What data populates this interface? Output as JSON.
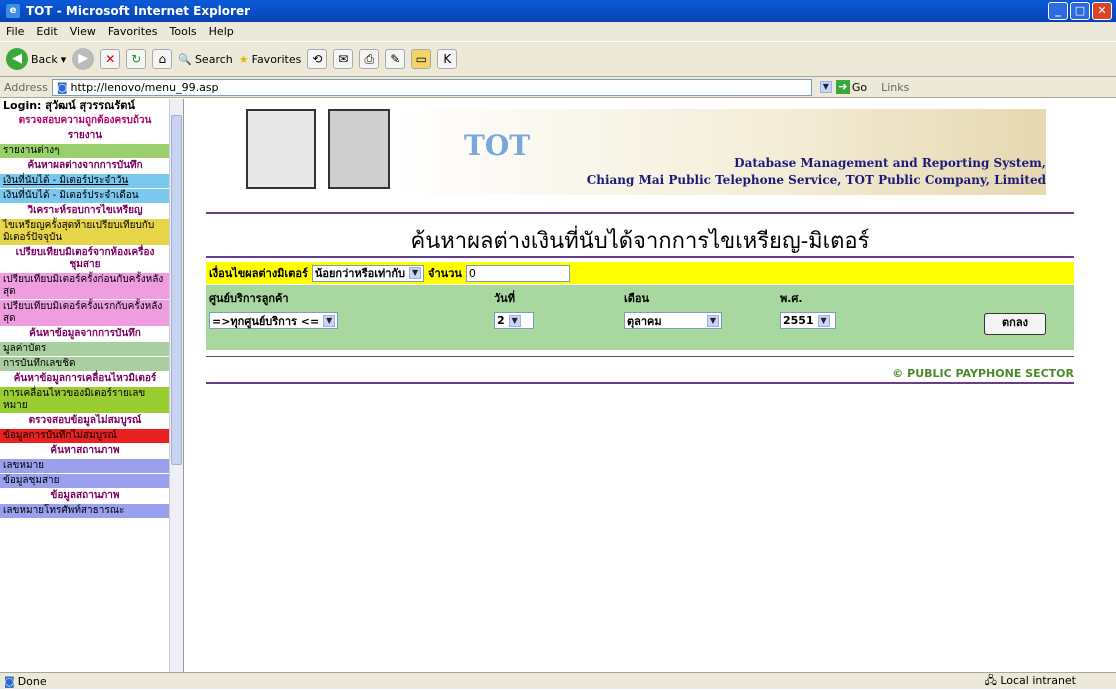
{
  "window": {
    "title": "TOT - Microsoft Internet Explorer"
  },
  "menu": [
    "File",
    "Edit",
    "View",
    "Favorites",
    "Tools",
    "Help"
  ],
  "toolbar": {
    "back": "Back",
    "search": "Search",
    "favorites": "Favorites"
  },
  "address": {
    "label": "Address",
    "url": "http://lenovo/menu_99.asp",
    "go": "Go",
    "links": "Links"
  },
  "sidebar": {
    "login": "Login: สุวัฒน์ สุวรรณรัตน์",
    "items": [
      {
        "text": "ตรวจสอบความถูกต้องครบถ้วน",
        "kind": "head-red"
      },
      {
        "text": "รายงาน",
        "kind": "head"
      },
      {
        "text": "รายงานต่างๆ",
        "kind": "green"
      },
      {
        "text": "ค้นหาผลต่างจากการบันทึก",
        "kind": "head"
      },
      {
        "text": "เงินที่นับได้ - มิเตอร์ประจำวัน",
        "kind": "cyan"
      },
      {
        "text": "เงินที่นับได้ - มิเตอร์ประจำเดือน",
        "kind": "cyan"
      },
      {
        "text": "วิเคราะห์รอบการไขเหรียญ",
        "kind": "head"
      },
      {
        "text": "ไขเหรียญครั้งสุดท้ายเปรียบเทียบกับมิเตอร์ปัจจุบัน",
        "kind": "yellow"
      },
      {
        "text": "เปรียบเทียบมิเตอร์จากห้องเครื่องชุมสาย",
        "kind": "head"
      },
      {
        "text": "เปรียบเทียบมิเตอร์ครั้งก่อนกับครั้งหลังสุด",
        "kind": "pink"
      },
      {
        "text": "เปรียบเทียบมิเตอร์ครั้งแรกกับครั้งหลังสุด",
        "kind": "pink"
      },
      {
        "text": "ค้นหาข้อมูลจากการบันทึก",
        "kind": "head"
      },
      {
        "text": "มูลค่าบัตร",
        "kind": "greygreen"
      },
      {
        "text": "การบันทึกเลขชิด",
        "kind": "greygreen"
      },
      {
        "text": "ค้นหาข้อมูลการเคลื่อนไหวมิเตอร์",
        "kind": "head"
      },
      {
        "text": "การเคลื่อนไหวของมิเตอร์รายเลขหมาย",
        "kind": "lime"
      },
      {
        "text": "ตรวจสอบข้อมูลไม่สมบูรณ์",
        "kind": "head"
      },
      {
        "text": "ข้อมูลการบันทึกไม่สมบูรณ์",
        "kind": "red"
      },
      {
        "text": "ค้นหาสถานภาพ",
        "kind": "head"
      },
      {
        "text": "เลขหมาย",
        "kind": "violet"
      },
      {
        "text": "ข้อมูลชุมสาย",
        "kind": "violet"
      },
      {
        "text": "ข้อมูลสถานภาพ",
        "kind": "head"
      },
      {
        "text": "เลขหมายโทรศัพท์สาธารณะ",
        "kind": "violet"
      }
    ]
  },
  "banner": {
    "logo": "TOT",
    "line1": "Database Management and Reporting System,",
    "line2": "Chiang Mai Public Telephone Service, TOT Public Company, Limited"
  },
  "page": {
    "title": "ค้นหาผลต่างเงินที่นับได้จากการไขเหรียญ-มิเตอร์"
  },
  "filter": {
    "label": "เงื่อนไขผลต่างมิเตอร์",
    "operator": "น้อยกว่าหรือเท่ากับ",
    "amount_label": "จำนวน",
    "amount": "0"
  },
  "form": {
    "center_label": "ศูนย์บริการลูกค้า",
    "center_value": "=>ทุกศูนย์บริการ <=",
    "day_label": "วันที่",
    "day_value": "2",
    "month_label": "เดือน",
    "month_value": "ตุลาคม",
    "year_label": "พ.ศ.",
    "year_value": "2551",
    "submit": "ตกลง"
  },
  "footer": {
    "copyright": "© PUBLIC PAYPHONE SECTOR"
  },
  "status": {
    "left": "Done",
    "zone": "Local intranet"
  }
}
